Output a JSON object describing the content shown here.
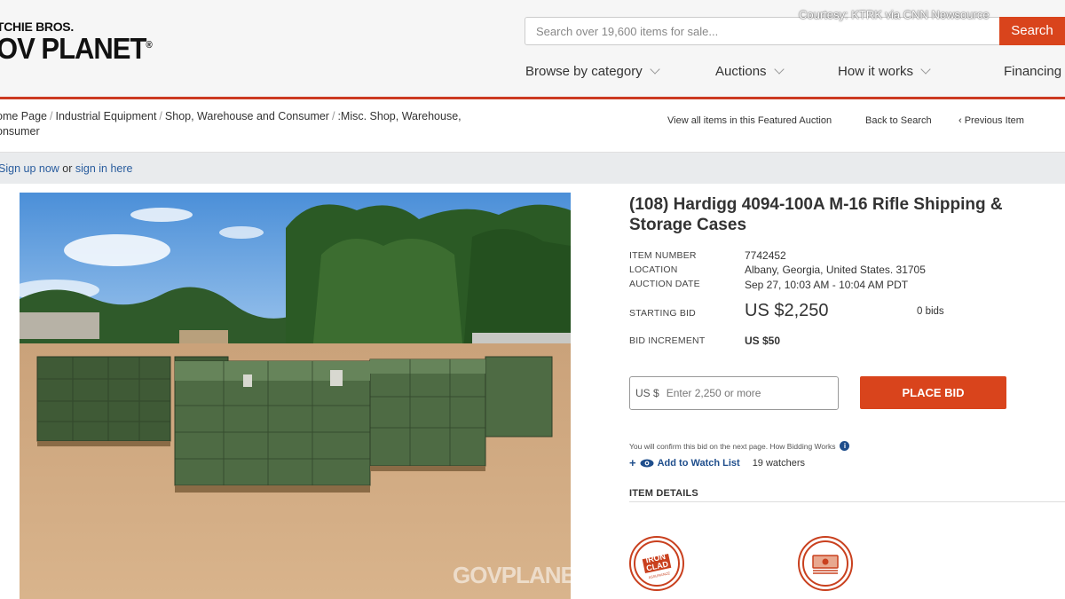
{
  "brand": {
    "line1": "TCHIE BROS.",
    "line2": "OV PLANET"
  },
  "overlay": {
    "courtesy": "Courtesy: KTRK via CNN Newsource"
  },
  "search": {
    "placeholder": "Search over 19,600 items for sale...",
    "button": "Search"
  },
  "nav": [
    {
      "label": "Browse by category"
    },
    {
      "label": "Auctions"
    },
    {
      "label": "How it works"
    },
    {
      "label": "Financing"
    }
  ],
  "breadcrumb": {
    "items": [
      "ome Page",
      "Industrial Equipment",
      "Shop, Warehouse and Consumer",
      ":Misc. Shop, Warehouse,"
    ],
    "tail": "onsumer"
  },
  "top_links": {
    "featured": "View all items in this Featured Auction",
    "back": "Back to Search",
    "previous": "‹ Previous Item"
  },
  "signin": {
    "signup": "Sign up now",
    "or": " or ",
    "signin": "sign in here"
  },
  "listing": {
    "title": "(108) Hardigg 4094-100A M-16 Rifle Shipping & Storage Cases",
    "item_number_label": "ITEM NUMBER",
    "item_number": "7742452",
    "location_label": "LOCATION",
    "location": "Albany, Georgia, United States. 31705",
    "auction_date_label": "AUCTION DATE",
    "auction_date": "Sep 27, 10:03 AM - 10:04 AM PDT",
    "starting_bid_label": "STARTING BID",
    "starting_bid": "US $2,250",
    "bids": "0 bids",
    "bid_increment_label": "BID INCREMENT",
    "bid_increment": "US $50"
  },
  "bid_form": {
    "prefix": "US $",
    "placeholder": "Enter 2,250 or more",
    "button": "PLACE BID",
    "confirm_text": "You will confirm this bid on the next page. How Bidding Works"
  },
  "watch": {
    "plus": "+",
    "link": "Add to Watch List",
    "watchers": "19 watchers"
  },
  "details": {
    "heading": "ITEM DETAILS"
  },
  "photo": {
    "watermark": "GOVPLANET"
  },
  "badges": {
    "iron_line1": "IRON",
    "iron_line2": "CLAD",
    "iron_line3": "ASSURANCE"
  },
  "colors": {
    "accent": "#d9441c",
    "link": "#1f4e8c",
    "header_rule": "#cc3a22"
  }
}
